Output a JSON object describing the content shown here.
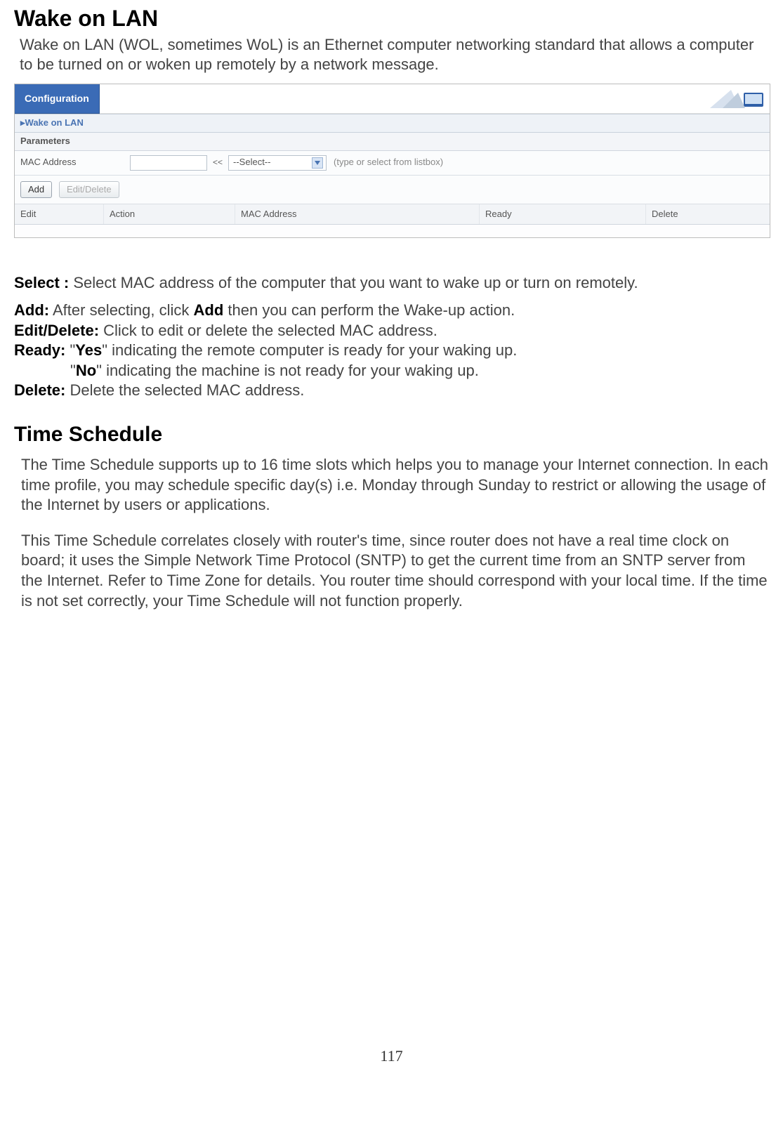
{
  "page_number": "117",
  "wol": {
    "heading": "Wake on LAN",
    "intro": "Wake on LAN (WOL, sometimes WoL) is an Ethernet computer networking standard that allows a computer to be turned on or woken up remotely by a network message."
  },
  "config_panel": {
    "tab_title": "Configuration",
    "section_title": "▸Wake on LAN",
    "subsection_title": "Parameters",
    "mac_label": "MAC Address",
    "mac_value": "",
    "chevron": "<<",
    "select_placeholder": "--Select--",
    "hint": "(type or select from listbox)",
    "add_button": "Add",
    "editdelete_button": "Edit/Delete",
    "columns": {
      "edit": "Edit",
      "action": "Action",
      "mac": "MAC Address",
      "ready": "Ready",
      "delete": "Delete"
    }
  },
  "defs": {
    "select_label": "Select :",
    "select_text": " Select  MAC address of the computer that you want to wake up or turn on remotely.",
    "add_label": "Add:",
    "add_text": "  After selecting, click ",
    "add_bold": "Add",
    "add_text2": " then you can perform the Wake-up action.",
    "editdelete_label": "Edit/Delete:",
    "editdelete_text": " Click to edit or delete the selected MAC address.",
    "ready_label": "Ready:",
    "ready_yes_pre": " \"",
    "ready_yes": "Yes",
    "ready_yes_post": "\"   indicating the remote computer is ready for your waking up.",
    "ready_no_pre": "\"",
    "ready_no": "No",
    "ready_no_post": "\"   indicating the machine is not ready for your waking up.",
    "delete_label": "Delete:",
    "delete_text": " Delete the selected MAC address."
  },
  "timeschedule": {
    "heading": "Time Schedule",
    "para1": "The Time Schedule supports up to 16 time slots which helps you to manage your Internet connection.  In each time profile, you may schedule specific day(s) i.e. Monday through Sunday to restrict or allowing the usage of the Internet by users or applications.",
    "para2": "This Time Schedule correlates closely with router's time, since router does not have a real time clock on board; it uses the Simple Network Time Protocol (SNTP) to get the current time from an SNTP server from the Internet. Refer to Time Zone for details.  You router time should correspond with your local time.  If the time is not set correctly, your Time Schedule will not function properly."
  }
}
